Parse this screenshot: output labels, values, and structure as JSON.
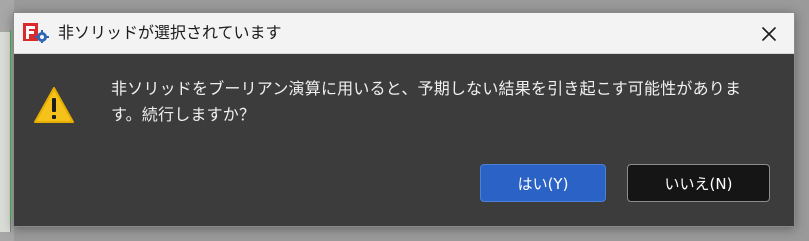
{
  "dialog": {
    "title": "非ソリッドが選択されています",
    "message": "非ソリッドをブーリアン演算に用いると、予期しない結果を引き起こす可能性があります。続行しますか？",
    "buttons": {
      "yes": "はい(Y)",
      "no": "いいえ(N)"
    },
    "icons": {
      "app": "freecad-icon",
      "warning": "warning-icon",
      "close": "close-icon"
    },
    "colors": {
      "warning_yellow": "#f4c21a",
      "primary_button": "#2a62c6",
      "dialog_background": "#3c3c3c",
      "title_background": "#f3f3f3"
    }
  }
}
